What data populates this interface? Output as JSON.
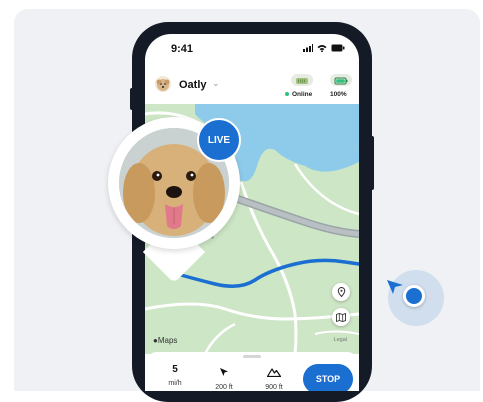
{
  "status_bar": {
    "time": "9:41"
  },
  "pet": {
    "name": "Oatly"
  },
  "device": {
    "connection": "Online",
    "battery": "100%"
  },
  "map": {
    "provider": "Maps",
    "legal": "Legal",
    "road_label": "B Dr"
  },
  "live_badge": "LIVE",
  "stats": [
    {
      "value": "5",
      "unit": "mi/h",
      "icon": "speed"
    },
    {
      "value": "",
      "unit": "200 ft",
      "icon": "navigation-arrow-icon"
    },
    {
      "value": "",
      "unit": "900 ft",
      "icon": "mountain-icon"
    }
  ],
  "stop_label": "STOP",
  "colors": {
    "accent": "#1a6fd1",
    "map_green": "#cde6c5",
    "water": "#8ecbea",
    "online": "#2ec27e"
  }
}
